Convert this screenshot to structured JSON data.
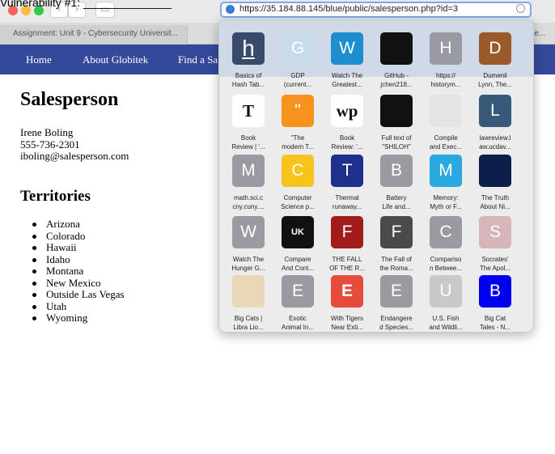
{
  "caption": "Vulnerability #1: ______________",
  "browser": {
    "url": "https://35.184.88.145/blue/public/salesperson.php?id=3",
    "tab_title": "Assignment: Unit 9 - Cybersecurity Universit...",
    "tab_right": "le..."
  },
  "site_nav": {
    "home": "Home",
    "about": "About Globitek",
    "find": "Find a Sa"
  },
  "page": {
    "heading": "Salesperson",
    "name": "Irene Boling",
    "phone": "555-736-2301",
    "email": "iboling@salesperson.com",
    "territories_heading": "Territories",
    "territories": [
      "Arizona",
      "Colorado",
      "Hawaii",
      "Idaho",
      "Montana",
      "New Mexico",
      "Outside Las Vegas",
      "Utah",
      "Wyoming"
    ]
  },
  "favorites": [
    [
      {
        "glyph": "h",
        "label": "Basics of\nHash Tab...",
        "color": "#3a4a6b",
        "icon": "h-logo-icon"
      },
      {
        "glyph": "G",
        "label": "GDP\n(current...",
        "color": "#c9dbe8",
        "icon": "letter-g-icon"
      },
      {
        "glyph": "W",
        "label": "Watch The\nGreatest...",
        "color": "#1e8ed0",
        "icon": "letter-w-icon"
      },
      {
        "glyph": "",
        "label": "GitHub -\njchen218...",
        "color": "#111111",
        "icon": "github-icon"
      },
      {
        "glyph": "H",
        "label": "https://\nhistorym...",
        "color": "#9a9aa2",
        "icon": "letter-h-icon"
      },
      {
        "glyph": "D",
        "label": "Dumenil\nLynn, The...",
        "color": "#9b5a2a",
        "icon": "letter-d-icon"
      }
    ],
    [
      {
        "glyph": "T",
        "label": "Book\nReview | '...",
        "color": "#ffffff",
        "icon": "nyt-icon"
      },
      {
        "glyph": "\"",
        "label": "\"The\nmodern T...",
        "color": "#f7921e",
        "icon": "quote-icon"
      },
      {
        "glyph": "wp",
        "label": "Book\nReview: '...",
        "color": "#ffffff",
        "icon": "washington-post-icon"
      },
      {
        "glyph": "",
        "label": "Full text of\n\"SHILOH\"",
        "color": "#111111",
        "icon": "archive-icon"
      },
      {
        "glyph": "",
        "label": "Compile\nand Exec...",
        "color": "#e4e4e4",
        "icon": "compile-icon"
      },
      {
        "glyph": "L",
        "label": "lawreview.l\naw.ucdav...",
        "color": "#385a78",
        "icon": "letter-l-icon"
      }
    ],
    [
      {
        "glyph": "M",
        "label": "math.sci.c\ncny.cuny....",
        "color": "#9a9aa2",
        "icon": "letter-m-icon"
      },
      {
        "glyph": "C",
        "label": "Computer\nScience p...",
        "color": "#f7c41e",
        "icon": "letter-c-icon"
      },
      {
        "glyph": "T",
        "label": "Thermal\nrunaway...",
        "color": "#1e2f8c",
        "icon": "letter-t-icon"
      },
      {
        "glyph": "B",
        "label": "Battery\nLife and...",
        "color": "#9a9aa2",
        "icon": "letter-b-icon"
      },
      {
        "glyph": "M",
        "label": "Memory:\nMyth or F...",
        "color": "#2aa8e0",
        "icon": "letter-m-icon"
      },
      {
        "glyph": "",
        "label": "The Truth\nAbout Ni...",
        "color": "#0c1e4a",
        "icon": "gear-icon"
      }
    ],
    [
      {
        "glyph": "W",
        "label": "Watch The\nHunger G...",
        "color": "#9a9aa2",
        "icon": "letter-w-icon"
      },
      {
        "glyph": "UK",
        "label": "Compare\nAnd Cont...",
        "color": "#111111",
        "icon": "ukessays-icon"
      },
      {
        "glyph": "F",
        "label": "THE FALL\nOF THE R...",
        "color": "#a31c1c",
        "icon": "letter-f-icon"
      },
      {
        "glyph": "F",
        "label": "The Fall of\nthe Roma...",
        "color": "#4a4a4a",
        "icon": "letter-f-icon"
      },
      {
        "glyph": "C",
        "label": "Compariso\nn Betwee...",
        "color": "#9a9aa2",
        "icon": "letter-c-icon"
      },
      {
        "glyph": "S",
        "label": "Socrates'\nThe Apol...",
        "color": "#d6b5bb",
        "icon": "letter-s-icon"
      }
    ],
    [
      {
        "glyph": "",
        "label": "Big Cats |\nLibra Lio...",
        "color": "#e8d8b8",
        "icon": "lion-icon"
      },
      {
        "glyph": "E",
        "label": "Exotic\nAnimal In...",
        "color": "#9a9aa2",
        "icon": "letter-e-icon"
      },
      {
        "glyph": "E",
        "label": "With Tigers\nNear Exti...",
        "color": "#e74b3c",
        "icon": "e360-icon"
      },
      {
        "glyph": "E",
        "label": "Endangere\nd Species...",
        "color": "#9a9aa2",
        "icon": "letter-e-icon"
      },
      {
        "glyph": "U",
        "label": "U.S. Fish\nand Wildli...",
        "color": "#c9c9cc",
        "icon": "letter-u-icon"
      },
      {
        "glyph": "B",
        "label": "Big Cat\nTales - N...",
        "color": "#0000f0",
        "icon": "letter-b-icon"
      }
    ]
  ]
}
